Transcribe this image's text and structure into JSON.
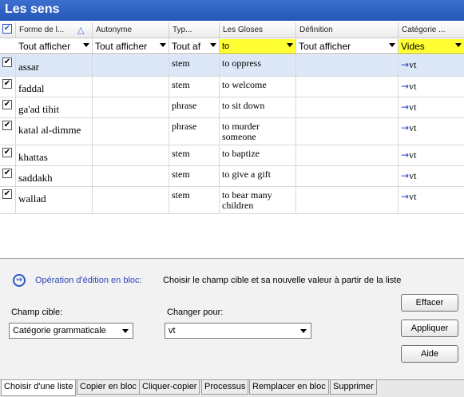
{
  "window": {
    "title": "Les sens"
  },
  "columns": {
    "select_all_checked": "✔",
    "headers": [
      "Forme de l...",
      "Autonyme",
      "Typ...",
      "Les Gloses",
      "Définition",
      "Catégorie ..."
    ],
    "sort_icon": "triangle-up-icon"
  },
  "filters": [
    "Tout afficher",
    "Tout afficher",
    "Tout af",
    "to",
    "Tout afficher",
    "Vides"
  ],
  "rows": [
    {
      "checked": "✔",
      "form": "assar",
      "autonym": "",
      "type": "stem",
      "gloss": "to oppress",
      "definition": "",
      "category": "vt"
    },
    {
      "checked": "✔",
      "form": "faddal",
      "autonym": "",
      "type": "stem",
      "gloss": "to welcome",
      "definition": "",
      "category": "vt"
    },
    {
      "checked": "✔",
      "form": "ga'ad tihit",
      "autonym": "",
      "type": "phrase",
      "gloss": "to sit down",
      "definition": "",
      "category": "vt"
    },
    {
      "checked": "✔",
      "form": "katal al-dimme",
      "autonym": "",
      "type": "phrase",
      "gloss": "to murder someone",
      "definition": "",
      "category": "vt"
    },
    {
      "checked": "✔",
      "form": "khattas",
      "autonym": "",
      "type": "stem",
      "gloss": "to baptize",
      "definition": "",
      "category": "vt"
    },
    {
      "checked": "✔",
      "form": "saddakh",
      "autonym": "",
      "type": "stem",
      "gloss": "to give a gift",
      "definition": "",
      "category": "vt"
    },
    {
      "checked": "✔",
      "form": "wallad",
      "autonym": "",
      "type": "stem",
      "gloss": "to bear many children",
      "definition": "",
      "category": "vt"
    }
  ],
  "category_arrow": "→",
  "bulk_edit": {
    "op_icon": "circle-arrow-icon",
    "op_label": "Opération d'édition en bloc:",
    "op_description": "Choisir le champ cible et sa nouvelle valeur à partir de la liste",
    "target_label": "Champ cible:",
    "target_value": "Catégorie grammaticale",
    "change_label": "Changer pour:",
    "change_value": "vt",
    "clear_button": "Effacer",
    "apply_button": "Appliquer",
    "help_button": "Aide"
  },
  "tabs": [
    "Choisir d'une liste",
    "Copier en bloc",
    "Cliquer-copier",
    "Processus",
    "Remplacer en bloc",
    "Supprimer"
  ]
}
